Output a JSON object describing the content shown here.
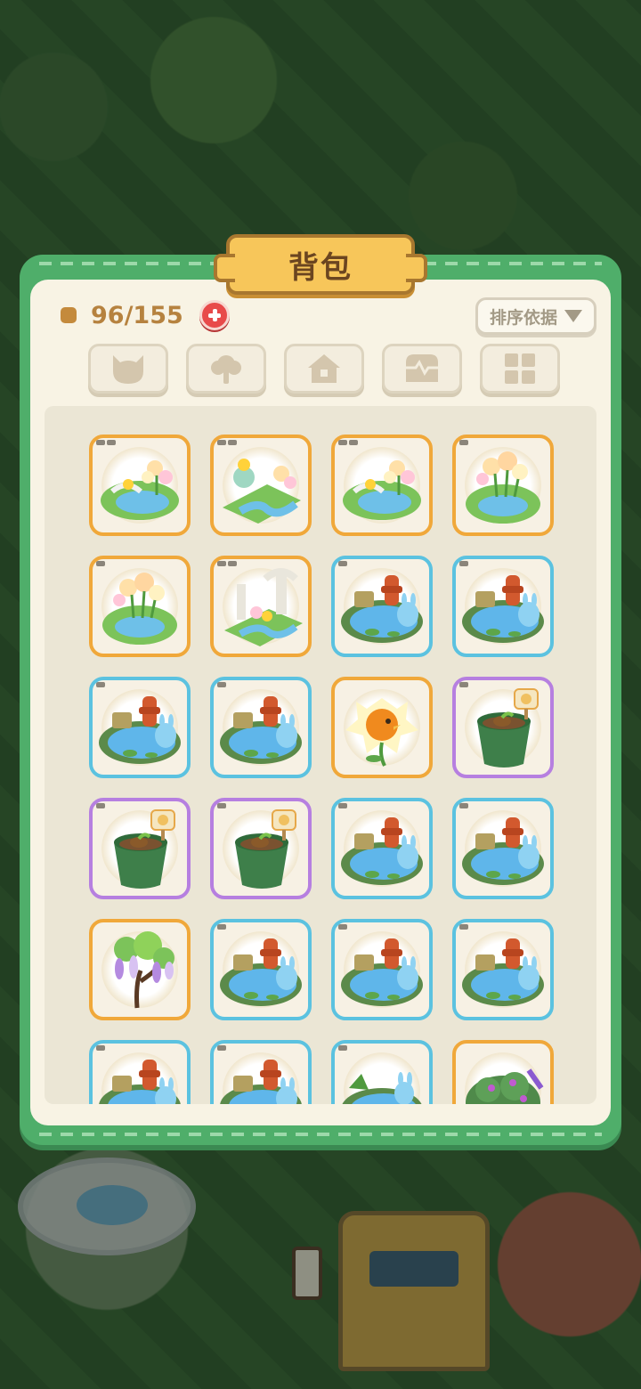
{
  "panel": {
    "title": "背包",
    "capacity": "96/155",
    "sort_label": "排序依据"
  },
  "tabs": [
    {
      "icon": "cat-head-icon"
    },
    {
      "icon": "tree-icon"
    },
    {
      "icon": "house-icon"
    },
    {
      "icon": "treasure-chest-icon"
    },
    {
      "icon": "grid-icon"
    }
  ],
  "colors": {
    "rarity_orange": "#f0a83a",
    "rarity_blue": "#5bc2e0",
    "rarity_purple": "#b67fe0",
    "panel_green": "#4fae6a",
    "panel_cream": "#f8f3e4",
    "title_gold": "#f7c65a"
  },
  "items": [
    {
      "name": "flower-bridge-pond",
      "rarity": "orange",
      "tags": 2
    },
    {
      "name": "flower-stream-garden",
      "rarity": "orange",
      "tags": 2
    },
    {
      "name": "flower-bridge-pond",
      "rarity": "orange",
      "tags": 2
    },
    {
      "name": "flower-pond",
      "rarity": "orange",
      "tags": 1
    },
    {
      "name": "flower-pond",
      "rarity": "orange",
      "tags": 1
    },
    {
      "name": "ruins-flower-stream",
      "rarity": "orange",
      "tags": 2
    },
    {
      "name": "bunny-hydrant-pond",
      "rarity": "blue",
      "tags": 1
    },
    {
      "name": "bunny-hydrant-pond",
      "rarity": "blue",
      "tags": 1
    },
    {
      "name": "bunny-hydrant-pond",
      "rarity": "blue",
      "tags": 1
    },
    {
      "name": "bunny-hydrant-pond",
      "rarity": "blue",
      "tags": 1
    },
    {
      "name": "chick-flower",
      "rarity": "orange",
      "tags": 0
    },
    {
      "name": "seedling-pot",
      "rarity": "purple",
      "tags": 1
    },
    {
      "name": "seedling-pot",
      "rarity": "purple",
      "tags": 1
    },
    {
      "name": "seedling-pot",
      "rarity": "purple",
      "tags": 1
    },
    {
      "name": "bunny-hydrant-pond",
      "rarity": "blue",
      "tags": 1
    },
    {
      "name": "bunny-hydrant-pond",
      "rarity": "blue",
      "tags": 1
    },
    {
      "name": "wisteria-tree",
      "rarity": "orange",
      "tags": 0
    },
    {
      "name": "bunny-hydrant-pond",
      "rarity": "blue",
      "tags": 1
    },
    {
      "name": "bunny-hydrant-pond",
      "rarity": "blue",
      "tags": 1
    },
    {
      "name": "bunny-hydrant-pond",
      "rarity": "blue",
      "tags": 1
    },
    {
      "name": "bunny-hydrant-pond",
      "rarity": "blue",
      "tags": 1
    },
    {
      "name": "bunny-hydrant-pond",
      "rarity": "blue",
      "tags": 1
    },
    {
      "name": "bunny-lily-pond",
      "rarity": "blue",
      "tags": 1
    },
    {
      "name": "flower-bush",
      "rarity": "orange",
      "tags": 0
    }
  ]
}
